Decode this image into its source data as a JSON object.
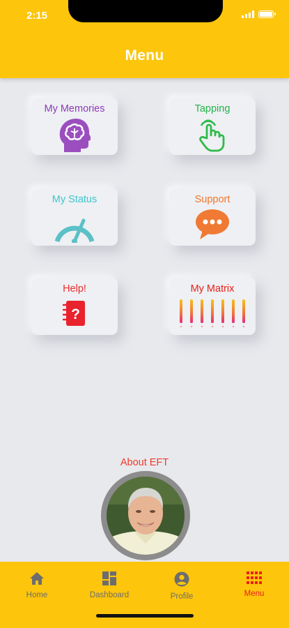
{
  "status_bar": {
    "time": "2:15"
  },
  "header": {
    "title": "Menu"
  },
  "tiles": [
    {
      "label": "My Memories",
      "icon": "head-brain-icon",
      "color": "#8e3bb5"
    },
    {
      "label": "Tapping",
      "icon": "tap-hand-icon",
      "color": "#22b34a"
    },
    {
      "label": "My Status",
      "icon": "gauge-icon",
      "color": "#3cc6cf"
    },
    {
      "label": "Support",
      "icon": "chat-bubble-icon",
      "color": "#f0762a"
    },
    {
      "label": "Help!",
      "icon": "help-notebook-icon",
      "color": "#ec2b2b"
    },
    {
      "label": "My Matrix",
      "icon": "matrix-bars-icon",
      "color": "#e8201a"
    }
  ],
  "about": {
    "label": "About EFT",
    "avatar": "presenter-photo"
  },
  "bottom_nav": {
    "items": [
      {
        "label": "Home",
        "icon": "home-icon",
        "active": false
      },
      {
        "label": "Dashboard",
        "icon": "dashboard-icon",
        "active": false
      },
      {
        "label": "Profile",
        "icon": "profile-icon",
        "active": false
      },
      {
        "label": "Menu",
        "icon": "grid-menu-icon",
        "active": true
      }
    ],
    "inactive_color": "#6d6d6d",
    "active_color": "#e8201a"
  },
  "colors": {
    "brand_yellow": "#fdc50c",
    "background": "#e8e9ed"
  }
}
